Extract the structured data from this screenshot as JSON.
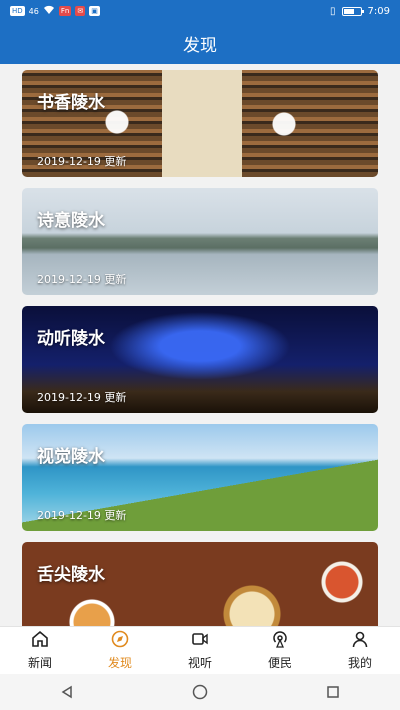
{
  "status_bar": {
    "left_chips": [
      "HD",
      "46",
      "ul",
      "BX",
      "Fn"
    ],
    "wifi_icon": "wifi-icon",
    "battery_level": 0.6,
    "time": "7:09"
  },
  "header": {
    "title": "发现"
  },
  "cards": [
    {
      "title": "书香陵水",
      "date": "2019-12-19 更新",
      "image": "library-interior"
    },
    {
      "title": "诗意陵水",
      "date": "2019-12-19 更新",
      "image": "misty-lake"
    },
    {
      "title": "动听陵水",
      "date": "2019-12-19 更新",
      "image": "concert-stage"
    },
    {
      "title": "视觉陵水",
      "date": "2019-12-19 更新",
      "image": "coastal-bay"
    },
    {
      "title": "舌尖陵水",
      "date": "",
      "image": "food-spread"
    }
  ],
  "bottom_nav": {
    "items": [
      {
        "label": "新闻",
        "icon": "home-icon"
      },
      {
        "label": "发现",
        "icon": "compass-icon"
      },
      {
        "label": "视听",
        "icon": "video-icon"
      },
      {
        "label": "便民",
        "icon": "signal-icon"
      },
      {
        "label": "我的",
        "icon": "person-icon"
      }
    ],
    "active_index": 1,
    "accent": "#e08a1e"
  },
  "colors": {
    "primary": "#1d6fc4"
  }
}
